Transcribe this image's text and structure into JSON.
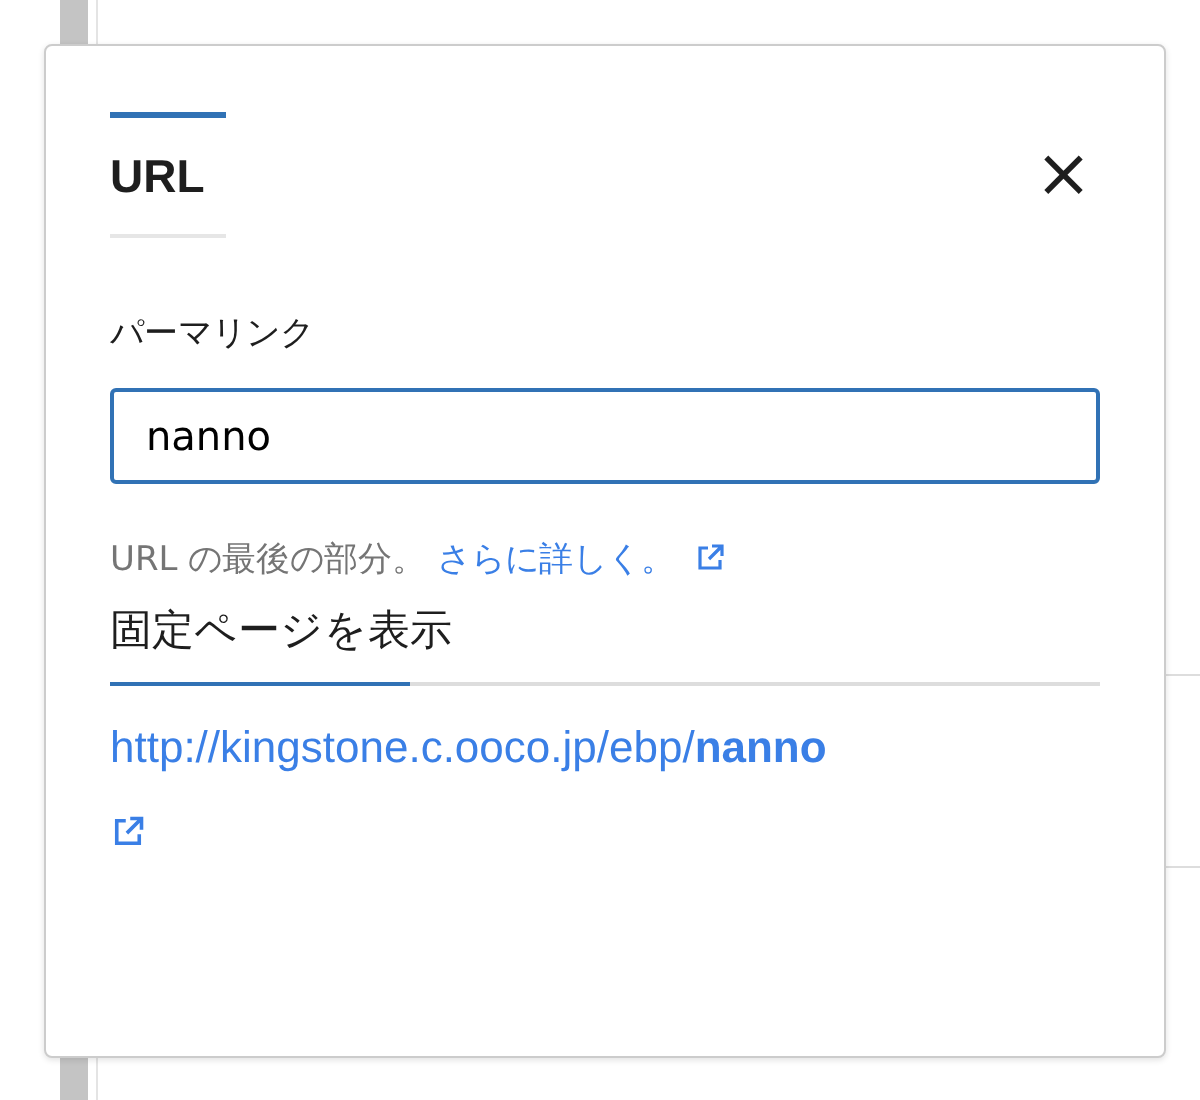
{
  "popover": {
    "title": "URL",
    "close": "×",
    "permalink": {
      "label": "パーマリンク",
      "value": "nanno"
    },
    "help": {
      "text": "URL の最後の部分。",
      "link": "さらに詳しく。"
    },
    "view_heading": "固定ページを表示",
    "url": "http://kingstone.c.ooco.jp/ebp/**nanno**"
  }
}
